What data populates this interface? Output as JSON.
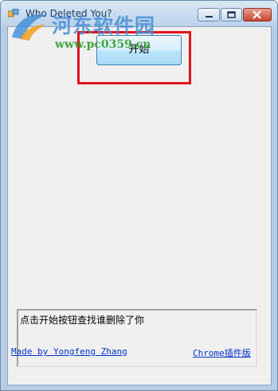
{
  "window": {
    "title": "Who Deleted You?"
  },
  "watermark": {
    "site_name": "河东软件园",
    "url": "www.pc0359.cn"
  },
  "main": {
    "start_button_label": "开始",
    "status_text": "点击开始按钮查找谁删除了你"
  },
  "footer": {
    "author_link": "Made by Yongfeng Zhang",
    "chrome_link": "Chrome插件版"
  },
  "colors": {
    "highlight": "#e0141e",
    "link": "#0033cc",
    "client_bg": "#f0f0f0"
  }
}
